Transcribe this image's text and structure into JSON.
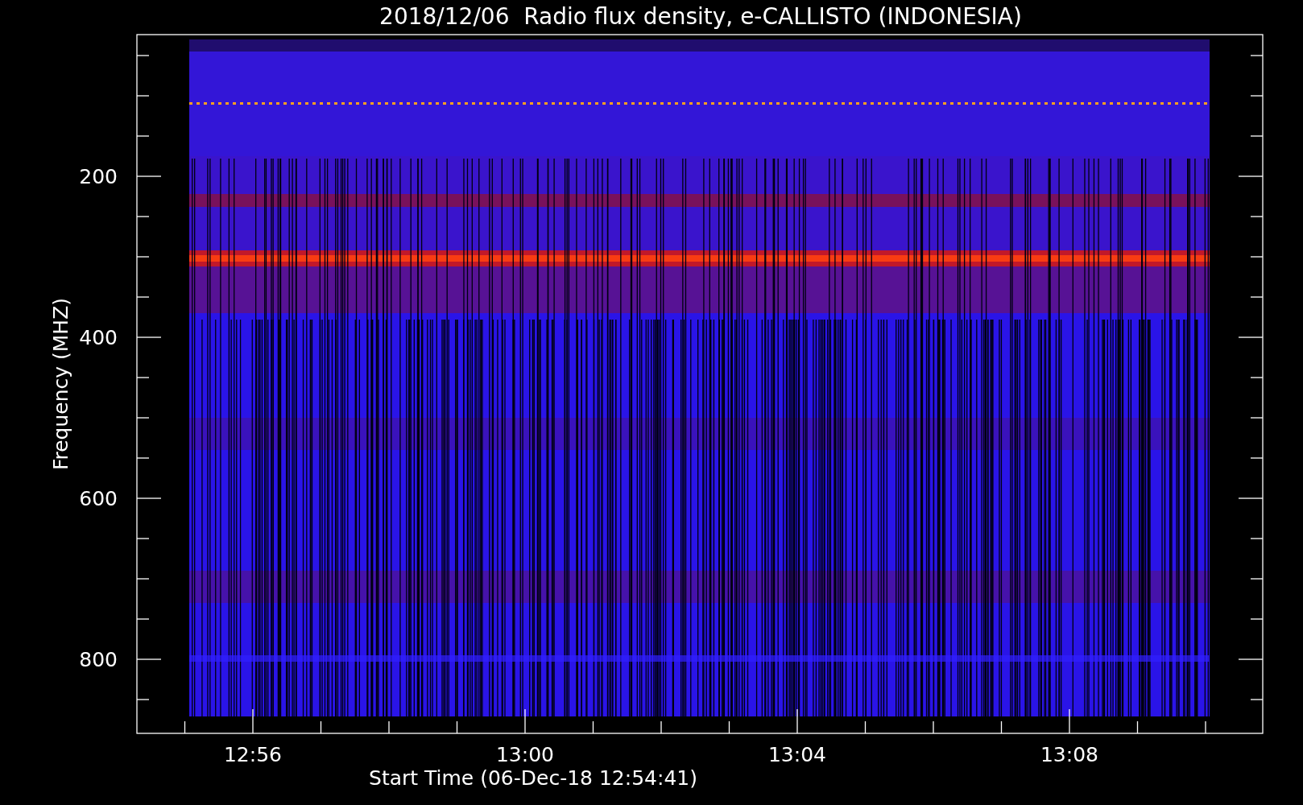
{
  "title": "2018/12/06  Radio flux density, e-CALLISTO (INDONESIA)",
  "plot": {
    "ylabel": "Frequency (MHZ)",
    "xlabel": "Start Time (06-Dec-18 12:54:41)",
    "yticks": [
      {
        "label": "200"
      },
      {
        "label": "400"
      },
      {
        "label": "600"
      },
      {
        "label": "800"
      }
    ],
    "xticks": [
      {
        "label": "12:56"
      },
      {
        "label": "13:00"
      },
      {
        "label": "13:04"
      },
      {
        "label": "13:08"
      }
    ]
  }
}
